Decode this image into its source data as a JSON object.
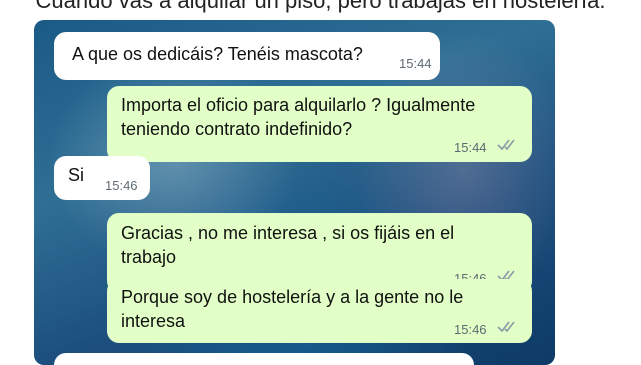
{
  "caption": "Cuando vas a alquilar un piso, pero trabajas en hostelería.",
  "messages": [
    {
      "type": "in",
      "text": "A que os dedicáis? Tenéis mascota?",
      "time": "15:44"
    },
    {
      "type": "out",
      "text": "Importa el oficio para alquilarlo ? Igualmente\nteniendo contrato indefinido?",
      "time": "15:44",
      "status": "read-ticks-icon"
    },
    {
      "type": "in",
      "text": "Si",
      "time": "15:46"
    },
    {
      "type": "out",
      "text": "Gracias , no me interesa , si os fijáis en el\ntrabajo",
      "time": "15:46",
      "status": "read-ticks-icon"
    },
    {
      "type": "out",
      "text": "Porque soy de hostelería y a la gente no le\ninteresa",
      "time": "15:46",
      "status": "read-ticks-icon"
    }
  ],
  "colors": {
    "incoming_bubble": "#ffffff",
    "outgoing_bubble": "#e2ffc7",
    "tick": "#8a9aa6"
  }
}
